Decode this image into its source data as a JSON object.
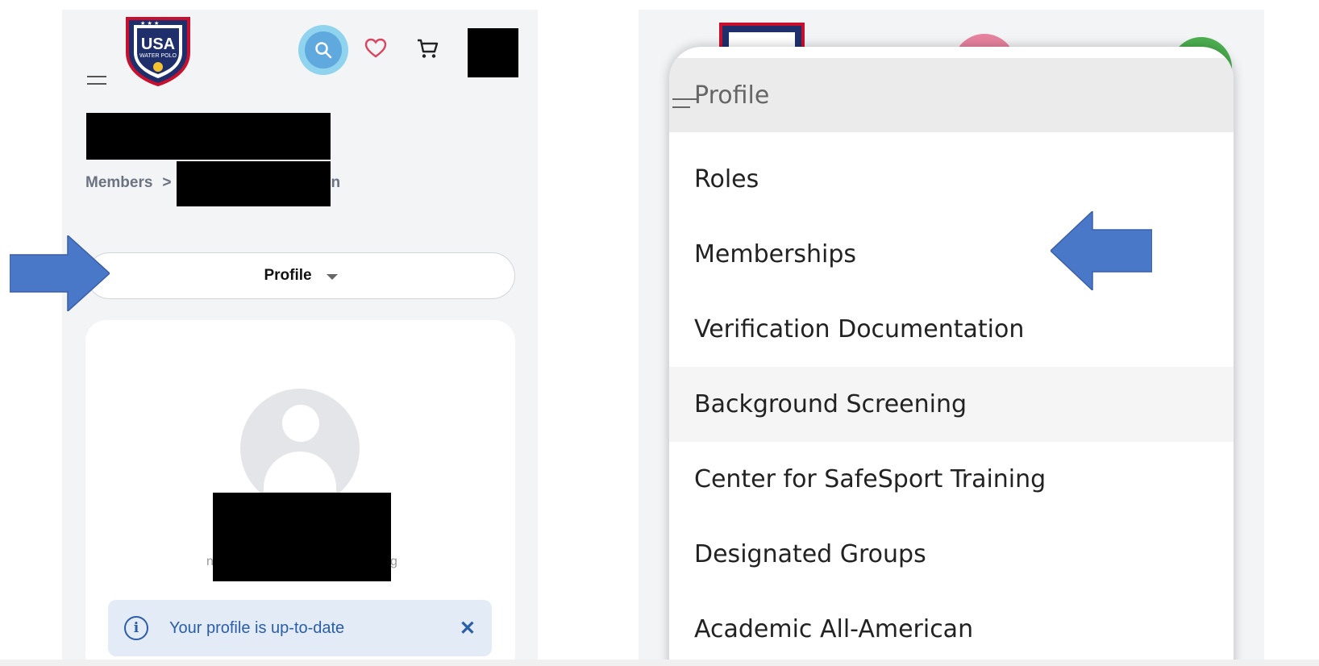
{
  "left": {
    "logo": {
      "line1": "USA",
      "line2": "WATER POLO"
    },
    "breadcrumb": {
      "first": "Members",
      "separator": ">",
      "tail": "n"
    },
    "profile_select": {
      "label": "Profile"
    },
    "card": {
      "frag_left": "n",
      "frag_right": "g"
    },
    "alert": {
      "text": "Your profile is up-to-date",
      "close": "✕",
      "icon": "i"
    }
  },
  "right": {
    "menu": {
      "header": "Profile",
      "items": [
        {
          "label": "Roles"
        },
        {
          "label": "Memberships"
        },
        {
          "label": "Verification Documentation"
        },
        {
          "label": "Background Screening"
        },
        {
          "label": "Center for SafeSport Training"
        },
        {
          "label": "Designated Groups"
        },
        {
          "label": "Academic All-American"
        }
      ]
    }
  },
  "colors": {
    "accent_blue": "#4a78c9",
    "alert_text": "#2b5ea8",
    "alert_bg": "#e3ebf6",
    "heart": "#d9455f",
    "search_bg": "#5fa9de"
  },
  "icons": [
    "hamburger-icon",
    "search-icon",
    "heart-icon",
    "cart-icon",
    "info-icon",
    "close-icon",
    "caret-down-icon",
    "user-placeholder-icon",
    "arrow-right-annotation",
    "arrow-left-annotation"
  ]
}
